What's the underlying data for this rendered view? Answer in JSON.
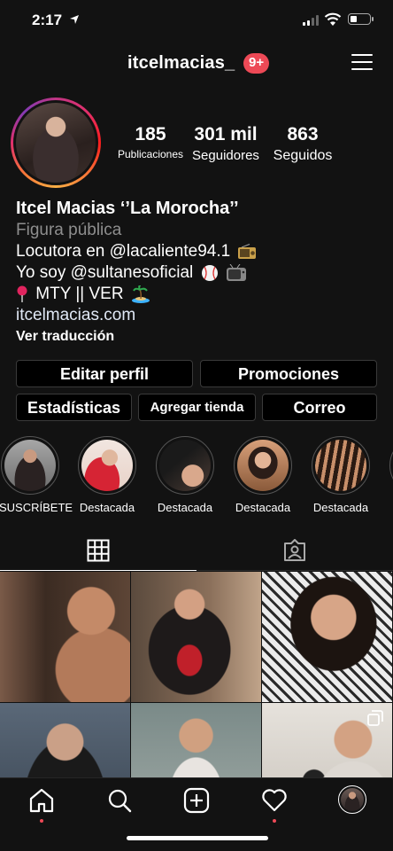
{
  "status_bar": {
    "time": "2:17"
  },
  "header": {
    "username": "itcelmacias_",
    "notifications_badge": "9+"
  },
  "profile": {
    "stats": [
      {
        "value": "185",
        "label": "Publicaciones"
      },
      {
        "value": "301 mil",
        "label": "Seguidores"
      },
      {
        "value": "863",
        "label": "Seguidos"
      }
    ],
    "name": "Itcel Macias ‘’La Morocha’’",
    "category": "Figura pública",
    "bio_lines": [
      "Locutora en @lacaliente94.1",
      "Yo soy @sultanesoficial",
      "MTY || VER"
    ],
    "website": "itcelmacias.com",
    "translate": "Ver traducción"
  },
  "actions": {
    "edit_profile": "Editar perfil",
    "promotions": "Promociones",
    "statistics": "Estadísticas",
    "add_shop": "Agregar tienda",
    "email": "Correo"
  },
  "highlights": [
    {
      "label": "SUSCRÍBETE"
    },
    {
      "label": "Destacada"
    },
    {
      "label": "Destacada"
    },
    {
      "label": "Destacada"
    },
    {
      "label": "Destacada"
    }
  ],
  "tabs": [
    {
      "icon": "grid-icon",
      "active": true
    },
    {
      "icon": "tagged-icon",
      "active": false
    }
  ],
  "bottom_nav": [
    {
      "icon": "home-icon"
    },
    {
      "icon": "search-icon"
    },
    {
      "icon": "add-post-icon"
    },
    {
      "icon": "heart-icon"
    },
    {
      "icon": "profile-avatar-icon"
    }
  ],
  "colors": {
    "accent_badge": "#ed4956",
    "background": "#121212"
  }
}
